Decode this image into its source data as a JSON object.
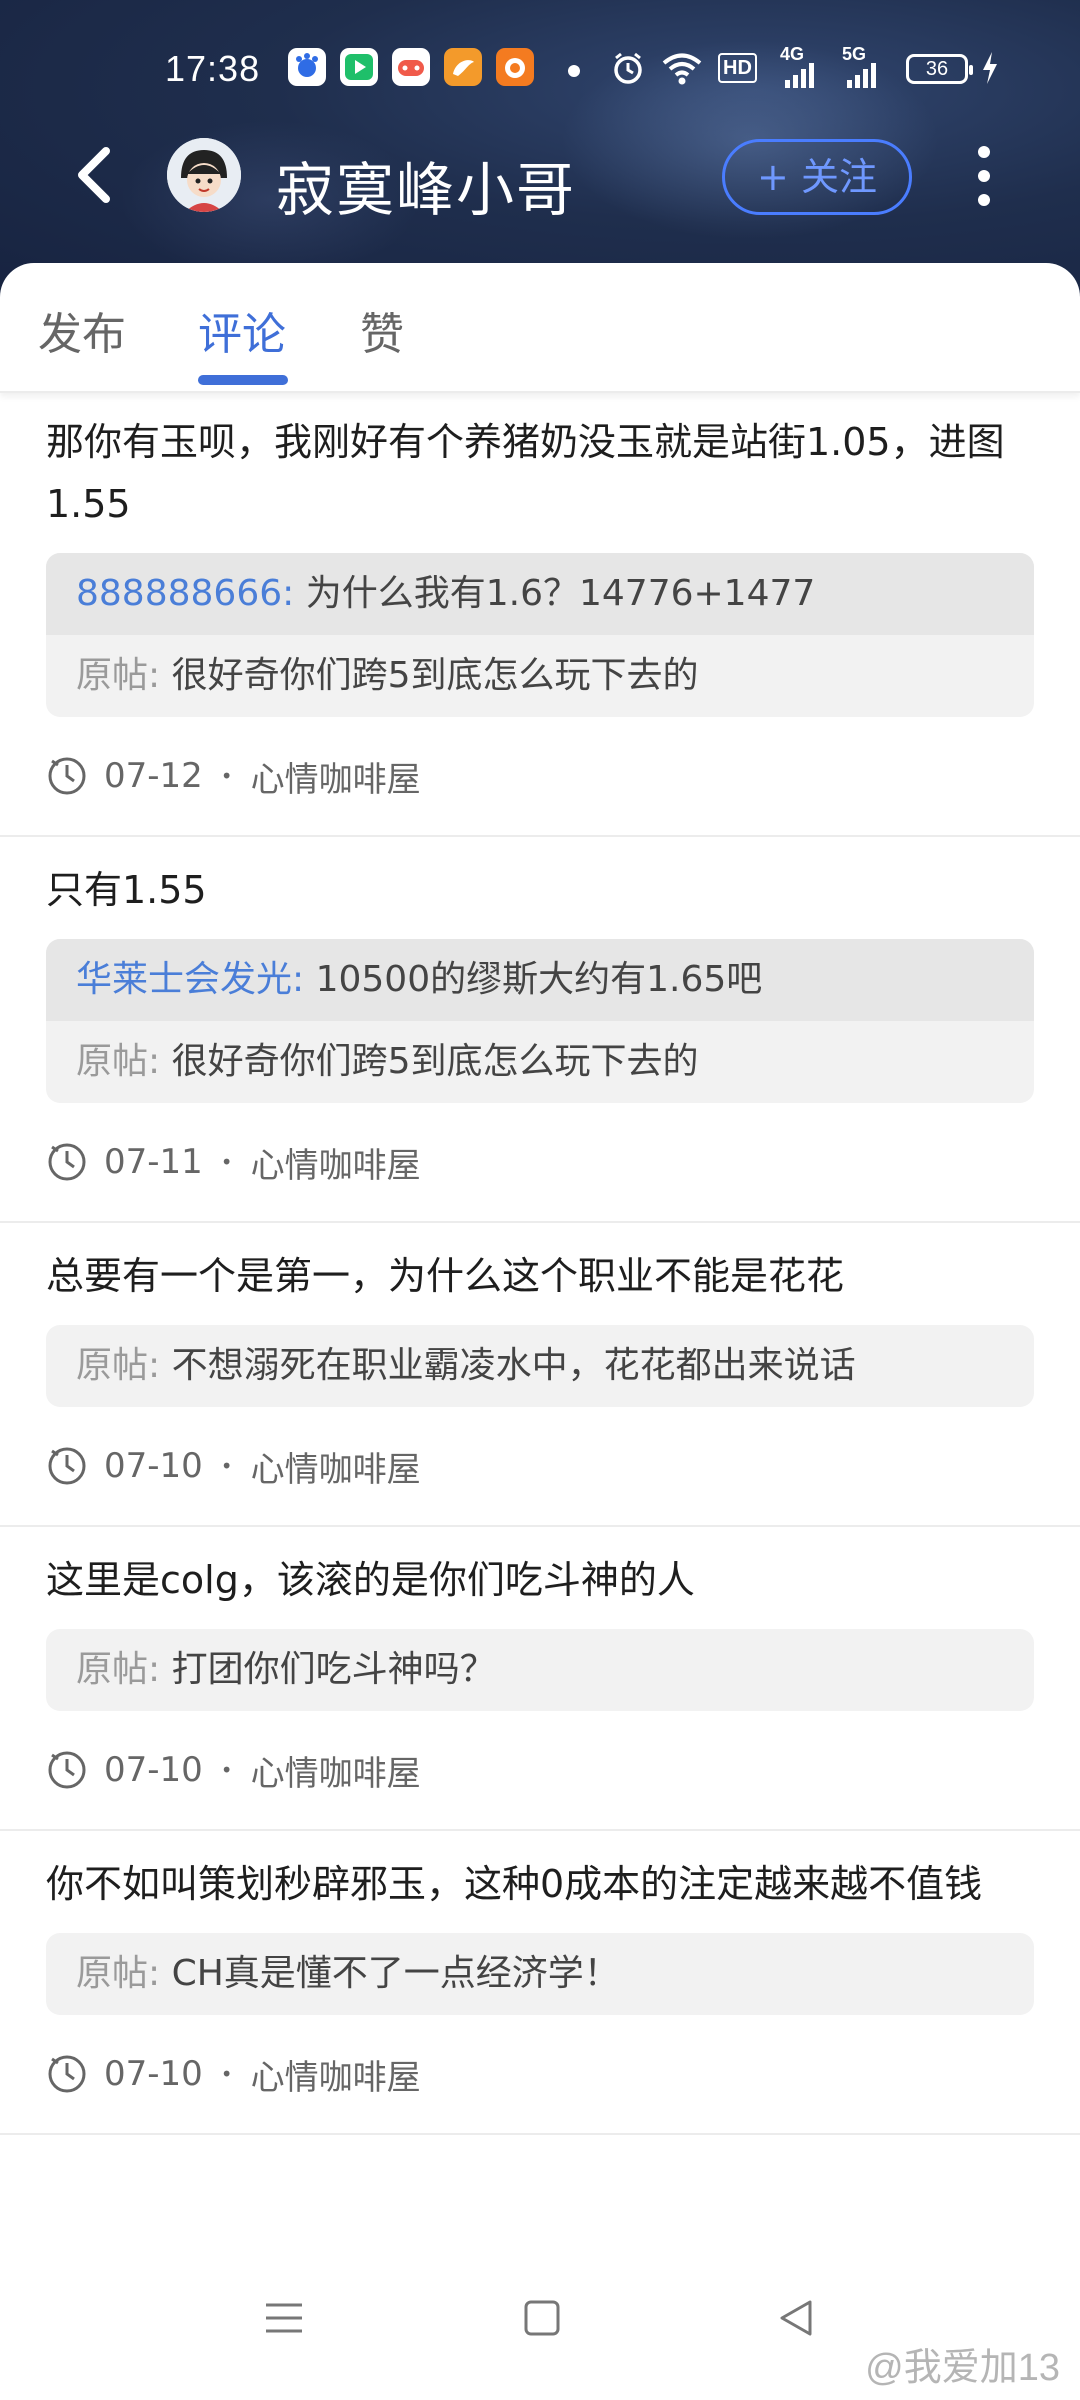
{
  "status_bar": {
    "time": "17:38",
    "network_label_1": "HD",
    "network_label_2": "4G",
    "network_label_3": "5G",
    "battery": "36"
  },
  "header": {
    "back_icon": "back-arrow-icon",
    "title": "寂寞峰小哥",
    "follow_label": "+ 关注",
    "more_icon": "more-vertical-icon"
  },
  "tabs": [
    {
      "label": "发布"
    },
    {
      "label": "评论"
    },
    {
      "label": "赞"
    }
  ],
  "active_tab": "评论",
  "comments": [
    {
      "text": "那你有玉呗，我刚好有个养猪奶没玉就是站街1.05，进图1.55",
      "reply_user": "888888666:",
      "reply_text": "为什么我有1.6？14776+1477",
      "orig_label": "原帖:",
      "orig_text": "很好奇你们跨5到底怎么玩下去的",
      "date": "07-12",
      "forum": "心情咖啡屋"
    },
    {
      "text": "只有1.55",
      "reply_user": "华莱士会发光:",
      "reply_text": "10500的缪斯大约有1.65吧",
      "orig_label": "原帖:",
      "orig_text": "很好奇你们跨5到底怎么玩下去的",
      "date": "07-11",
      "forum": "心情咖啡屋"
    },
    {
      "text": "总要有一个是第一，为什么这个职业不能是花花",
      "orig_label": "原帖:",
      "orig_text": "不想溺死在职业霸凌水中，花花都出来说话",
      "date": "07-10",
      "forum": "心情咖啡屋"
    },
    {
      "text": "这里是colg，该滚的是你们吃斗神的人",
      "orig_label": "原帖:",
      "orig_text": "打团你们吃斗神吗？",
      "date": "07-10",
      "forum": "心情咖啡屋"
    },
    {
      "text": "你不如叫策划秒辟邪玉，这种0成本的注定越来越不值钱",
      "orig_label": "原帖:",
      "orig_text": "CH真是懂不了一点经济学！",
      "date": "07-10",
      "forum": "心情咖啡屋"
    }
  ],
  "meta_separator": "•",
  "watermark": "@我爱加13",
  "nav_icons": [
    "menu-icon",
    "home-square-icon",
    "back-triangle-icon"
  ]
}
